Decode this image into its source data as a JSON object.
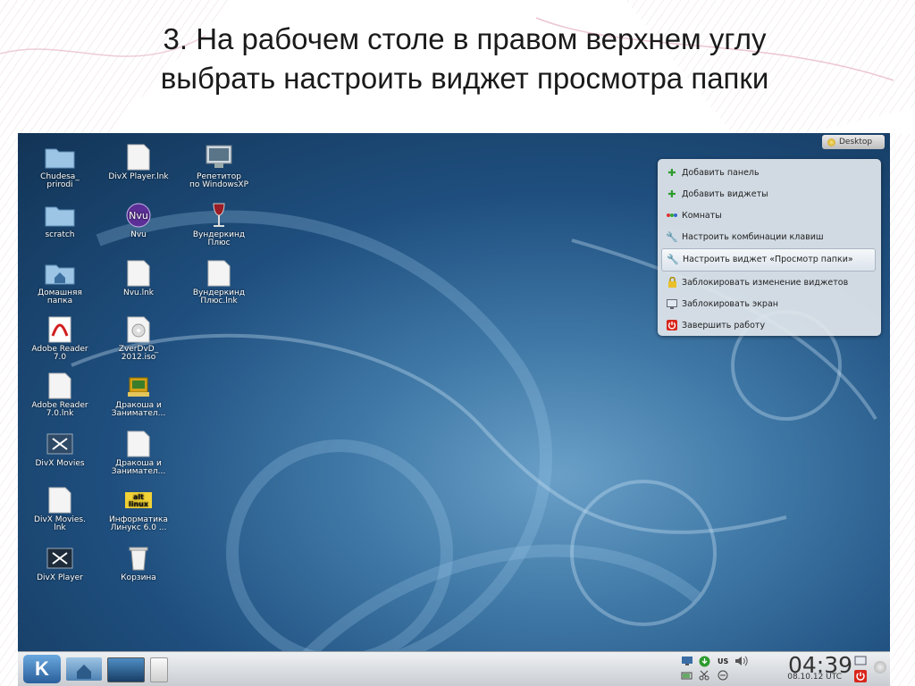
{
  "slide": {
    "title_line1": "3. На рабочем столе в правом верхнем углу",
    "title_line2": "выбрать настроить виджет просмотра папки"
  },
  "desktop": {
    "toolbox_label": "Desktop",
    "icons": [
      {
        "label": "Chudesa_\nprirodi",
        "icon": "folder-icon"
      },
      {
        "label": "scratch",
        "icon": "folder-icon"
      },
      {
        "label": "Домашняя\nпапка",
        "icon": "home-folder-icon"
      },
      {
        "label": "Adobe Reader\n7.0",
        "icon": "pdf-icon"
      },
      {
        "label": "Adobe Reader\n7.0.lnk",
        "icon": "file-icon"
      },
      {
        "label": "DivX Movies",
        "icon": "divx-icon"
      },
      {
        "label": "DivX Movies.\nlnk",
        "icon": "file-icon"
      },
      {
        "label": "DivX Player",
        "icon": "divx-icon"
      },
      {
        "label": "DivX Player.lnk",
        "icon": "file-icon"
      },
      {
        "label": "Nvu",
        "icon": "nvu-icon"
      },
      {
        "label": "Nvu.lnk",
        "icon": "file-icon"
      },
      {
        "label": "ZverDvD_\n2012.iso",
        "icon": "disc-icon"
      },
      {
        "label": "Дракоша и\nЗанимател...",
        "icon": "game-icon"
      },
      {
        "label": "Дракоша и\nЗанимател...",
        "icon": "file-icon"
      },
      {
        "label": "Информатика\nЛинукс 6.0 ...",
        "icon": "altlinux-icon"
      },
      {
        "label": "Корзина",
        "icon": "trash-icon"
      },
      {
        "label": "Репетитор\nпо WindowsXP",
        "icon": "monitor-icon"
      },
      {
        "label": "Вундеркинд\nПлюс",
        "icon": "wine-glass-icon"
      },
      {
        "label": "Вундеркинд\nПлюс.lnk",
        "icon": "file-icon"
      }
    ]
  },
  "menu": {
    "items": [
      {
        "label": "Добавить панель",
        "icon": "plus-icon"
      },
      {
        "label": "Добавить виджеты",
        "icon": "plus-icon"
      },
      {
        "label": "Комнаты",
        "icon": "activities-icon"
      },
      {
        "label": "Настроить комбинации клавиш",
        "icon": "wrench-icon"
      },
      {
        "label": "Настроить виджет «Просмотр папки»",
        "icon": "wrench-icon",
        "highlighted": true
      },
      {
        "label": "Заблокировать изменение виджетов",
        "icon": "lock-icon"
      },
      {
        "label": "Заблокировать экран",
        "icon": "screen-lock-icon"
      },
      {
        "label": "Завершить работу",
        "icon": "power-icon"
      }
    ]
  },
  "taskbar": {
    "kicker_label": "K",
    "clock": "04:39",
    "date": "08.10.12 UTC",
    "keyboard_layout": "US"
  }
}
